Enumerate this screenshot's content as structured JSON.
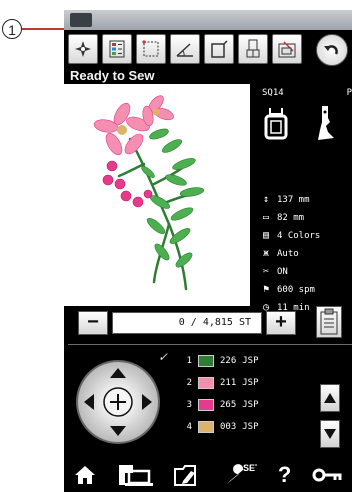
{
  "callout": {
    "number": "1"
  },
  "status": {
    "text": "Ready to Sew"
  },
  "toolbar": {
    "icons": [
      "pattern-icon",
      "color-group-icon",
      "trace-icon",
      "angle-icon",
      "hoop-position-icon",
      "bobbin-icon",
      "edit-icon"
    ]
  },
  "info": {
    "foot_code": "SQ14",
    "foot_letter": "P",
    "height": "137 mm",
    "width": "82 mm",
    "colors": "4 Colors",
    "mode": "Auto",
    "cutter": "ON",
    "speed": "600 spm",
    "time": "11 min"
  },
  "stitch": {
    "minus": "−",
    "value": "0 / 4,815 ST",
    "plus": "+"
  },
  "threads": [
    {
      "num": "1",
      "code": "226",
      "unit": "JSP",
      "color": "#2e7d32"
    },
    {
      "num": "2",
      "code": "211",
      "unit": "JSP",
      "color": "#f48fb1"
    },
    {
      "num": "3",
      "code": "265",
      "unit": "JSP",
      "color": "#e63a8c"
    },
    {
      "num": "4",
      "code": "003",
      "unit": "JSP",
      "color": "#d9b46a"
    }
  ],
  "check_mark": "✓",
  "bottom": {
    "set_label": "SET",
    "help_label": "?"
  }
}
